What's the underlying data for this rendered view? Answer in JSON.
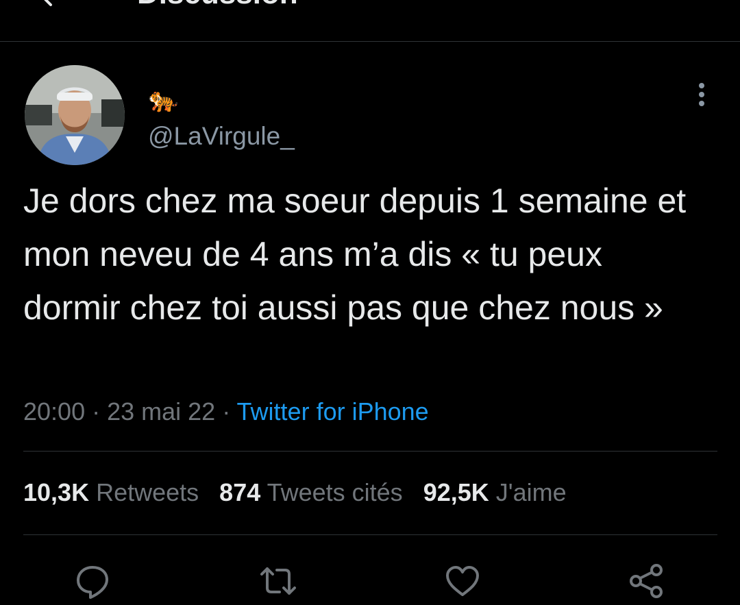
{
  "header": {
    "title": "Discussion",
    "back_icon": "arrow-left-icon"
  },
  "author": {
    "display_name": "🐅",
    "handle": "@LaVirgule_",
    "more_icon": "more-vertical-icon"
  },
  "tweet": {
    "text": "Je dors chez ma soeur depuis 1 semaine et mon neveu de 4 ans m’a dis « tu peux dormir chez toi aussi pas que chez nous »",
    "time": "20:00",
    "separator": " · ",
    "date": "23 mai 22",
    "source": "Twitter for iPhone"
  },
  "stats": {
    "retweets": {
      "count": "10,3K",
      "label": "Retweets"
    },
    "quotes": {
      "count": "874",
      "label": "Tweets cités"
    },
    "likes": {
      "count": "92,5K",
      "label": "J'aime"
    }
  },
  "actions": [
    "reply-icon",
    "retweet-icon",
    "like-icon",
    "share-icon"
  ],
  "colors": {
    "background": "#000000",
    "text": "#e7e9ea",
    "muted": "#71767b",
    "link": "#1d9bf0",
    "divider": "#2f3336"
  }
}
